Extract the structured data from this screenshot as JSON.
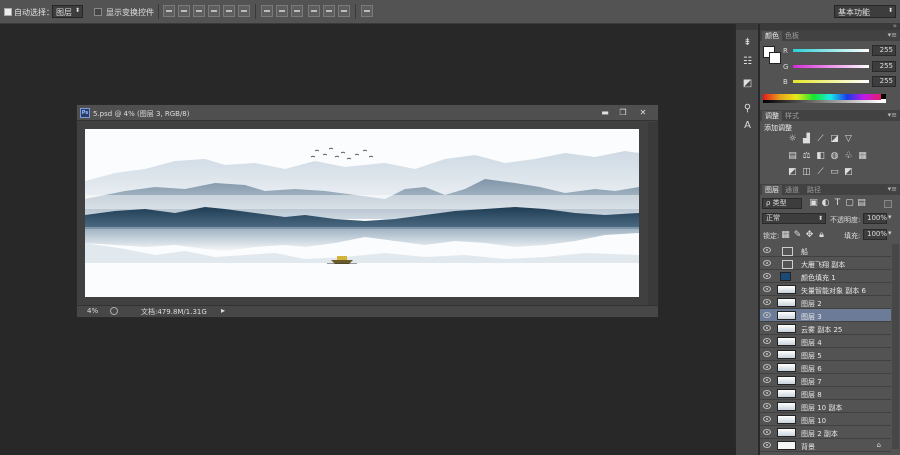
{
  "options_bar": {
    "auto_select_label": "自动选择：",
    "auto_select_value": "图层",
    "show_transform_label": "显示变换控件",
    "workspace": "基本功能"
  },
  "document": {
    "title": "5.psd @ 4% (图层 3, RGB/8)",
    "zoom": "4%",
    "doc_info": "文档:479.8M/1.31G",
    "window_buttons": [
      "▬",
      "❐",
      "✕"
    ]
  },
  "color_panel": {
    "tabs": [
      "颜色",
      "色板"
    ],
    "channels": [
      {
        "label": "R",
        "value": "255",
        "color": "#3fd3d6"
      },
      {
        "label": "G",
        "value": "255",
        "color": "#d43fd6"
      },
      {
        "label": "B",
        "value": "255",
        "color": "#e9e93a"
      }
    ]
  },
  "adjust_panel": {
    "tabs": [
      "调整",
      "样式"
    ],
    "heading": "添加调整"
  },
  "layers_panel": {
    "tabs": [
      "图层",
      "通道",
      "路径"
    ],
    "filter": "ρ 类型",
    "blend_mode": "正常",
    "opacity_label": "不透明度:",
    "opacity_value": "100%",
    "lock_label": "锁定:",
    "fill_label": "填充:",
    "fill_value": "100%",
    "layers": [
      {
        "name": "船",
        "thumb": "folder",
        "selected": false
      },
      {
        "name": "大雁飞翔 副本",
        "thumb": "folder",
        "selected": false
      },
      {
        "name": "颜色填充 1",
        "thumb": "colorfill",
        "selected": false
      },
      {
        "name": "矢量智能对象 副本 6",
        "thumb": "image",
        "selected": false
      },
      {
        "name": "图层 2",
        "thumb": "image",
        "selected": false
      },
      {
        "name": "图层 3",
        "thumb": "image",
        "selected": true
      },
      {
        "name": "云雾 副本 25",
        "thumb": "image",
        "selected": false
      },
      {
        "name": "图层 4",
        "thumb": "image",
        "selected": false
      },
      {
        "name": "图层 5",
        "thumb": "image",
        "selected": false
      },
      {
        "name": "图层 6",
        "thumb": "image",
        "selected": false
      },
      {
        "name": "图层 7",
        "thumb": "image",
        "selected": false
      },
      {
        "name": "图层 8",
        "thumb": "image",
        "selected": false
      },
      {
        "name": "图层 10 副本",
        "thumb": "image",
        "selected": false
      },
      {
        "name": "图层 10",
        "thumb": "image",
        "selected": false
      },
      {
        "name": "图层 2 副本",
        "thumb": "image",
        "selected": false
      },
      {
        "name": "背景",
        "thumb": "white",
        "selected": false
      }
    ]
  }
}
